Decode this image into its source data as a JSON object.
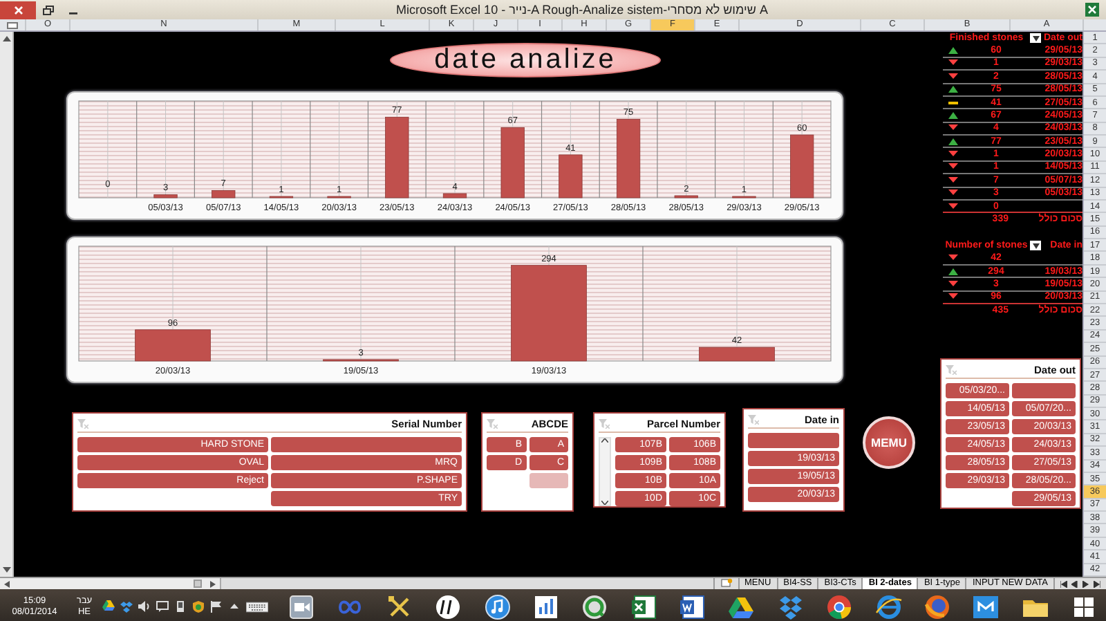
{
  "window": {
    "title": "Microsoft Excel 10 - נייר-A Rough-Analize sistem-שימוש לא מסחרי A"
  },
  "column_headers": [
    {
      "label": "O",
      "selected": false
    },
    {
      "label": "N",
      "selected": false
    },
    {
      "label": "M",
      "selected": false
    },
    {
      "label": "L",
      "selected": false
    },
    {
      "label": "K",
      "selected": false
    },
    {
      "label": "J",
      "selected": false
    },
    {
      "label": "I",
      "selected": false
    },
    {
      "label": "H",
      "selected": false
    },
    {
      "label": "G",
      "selected": false
    },
    {
      "label": "F",
      "selected": true
    },
    {
      "label": "E",
      "selected": false
    },
    {
      "label": "D",
      "selected": false
    },
    {
      "label": "C",
      "selected": false
    },
    {
      "label": "B",
      "selected": false
    },
    {
      "label": "A",
      "selected": false
    }
  ],
  "row_headers": [
    {
      "label": "1",
      "selected": false
    },
    {
      "label": "2",
      "selected": false
    },
    {
      "label": "3",
      "selected": false
    },
    {
      "label": "4",
      "selected": false
    },
    {
      "label": "5",
      "selected": false
    },
    {
      "label": "6",
      "selected": false
    },
    {
      "label": "7",
      "selected": false
    },
    {
      "label": "8",
      "selected": false
    },
    {
      "label": "9",
      "selected": false
    },
    {
      "label": "10",
      "selected": false
    },
    {
      "label": "11",
      "selected": false
    },
    {
      "label": "12",
      "selected": false
    },
    {
      "label": "13",
      "selected": false
    },
    {
      "label": "14",
      "selected": false
    },
    {
      "label": "15",
      "selected": false
    },
    {
      "label": "16",
      "selected": false
    },
    {
      "label": "17",
      "selected": false
    },
    {
      "label": "18",
      "selected": false
    },
    {
      "label": "19",
      "selected": false
    },
    {
      "label": "20",
      "selected": false
    },
    {
      "label": "21",
      "selected": false
    },
    {
      "label": "22",
      "selected": false
    },
    {
      "label": "23",
      "selected": false
    },
    {
      "label": "24",
      "selected": false
    },
    {
      "label": "25",
      "selected": false
    },
    {
      "label": "26",
      "selected": false
    },
    {
      "label": "27",
      "selected": false
    },
    {
      "label": "28",
      "selected": false
    },
    {
      "label": "29",
      "selected": false
    },
    {
      "label": "30",
      "selected": false
    },
    {
      "label": "31",
      "selected": false
    },
    {
      "label": "32",
      "selected": false
    },
    {
      "label": "33",
      "selected": false
    },
    {
      "label": "34",
      "selected": false
    },
    {
      "label": "35",
      "selected": false
    },
    {
      "label": "36",
      "selected": true
    },
    {
      "label": "37",
      "selected": false
    },
    {
      "label": "38",
      "selected": false
    },
    {
      "label": "39",
      "selected": false
    },
    {
      "label": "40",
      "selected": false
    },
    {
      "label": "41",
      "selected": false
    },
    {
      "label": "42",
      "selected": false
    }
  ],
  "banner": "date analize",
  "charts": [
    {
      "chart_data": {
        "type": "bar",
        "grid": true,
        "categories": [
          null,
          "05/03/13",
          "05/07/13",
          "14/05/13",
          "20/03/13",
          "23/05/13",
          "24/03/13",
          "24/05/13",
          "27/05/13",
          "28/05/13",
          "28/05/13",
          "29/03/13",
          "29/05/13"
        ],
        "values": [
          0,
          3,
          7,
          1,
          1,
          77,
          4,
          67,
          41,
          75,
          2,
          1,
          60
        ],
        "data_labels": true
      }
    },
    {
      "chart_data": {
        "type": "bar",
        "grid": true,
        "categories": [
          "20/03/13",
          "19/05/13",
          "19/03/13",
          null
        ],
        "values": [
          96,
          3,
          294,
          42
        ],
        "data_labels": true
      }
    }
  ],
  "finished_table": {
    "columns": [
      "Finished stones",
      "Date out"
    ],
    "rows": [
      {
        "kind": "up",
        "value": "60",
        "date": "29/05/13"
      },
      {
        "kind": "down",
        "value": "1",
        "date": "29/03/13"
      },
      {
        "kind": "down",
        "value": "2",
        "date": "28/05/13"
      },
      {
        "kind": "up",
        "value": "75",
        "date": "28/05/13"
      },
      {
        "kind": "flat",
        "value": "41",
        "date": "27/05/13"
      },
      {
        "kind": "up",
        "value": "67",
        "date": "24/05/13"
      },
      {
        "kind": "down",
        "value": "4",
        "date": "24/03/13"
      },
      {
        "kind": "up",
        "value": "77",
        "date": "23/05/13"
      },
      {
        "kind": "down",
        "value": "1",
        "date": "20/03/13"
      },
      {
        "kind": "down",
        "value": "1",
        "date": "14/05/13"
      },
      {
        "kind": "down",
        "value": "7",
        "date": "05/07/13"
      },
      {
        "kind": "down",
        "value": "3",
        "date": "05/03/13"
      },
      {
        "kind": "down",
        "value": "0"
      }
    ],
    "total": {
      "value": "339",
      "label": "סכום כולל"
    }
  },
  "number_table": {
    "columns": [
      "Number of stones",
      "Date in"
    ],
    "rows": [
      {
        "kind": "down",
        "value": "42"
      },
      {
        "kind": "up",
        "value": "294",
        "date": "19/03/13"
      },
      {
        "kind": "down",
        "value": "3",
        "date": "19/05/13"
      },
      {
        "kind": "down",
        "value": "96",
        "date": "20/03/13"
      }
    ],
    "total": {
      "value": "435",
      "label": "סכום כולל"
    }
  },
  "slicers": [
    {
      "title": "Serial Number",
      "items": [
        {
          "kind": "value",
          "label": "HARD STONE",
          "disabled": false
        },
        {
          "kind": "blank",
          "disabled": false
        },
        {
          "kind": "value",
          "label": "OVAL",
          "disabled": false
        },
        {
          "kind": "value",
          "label": "MRQ",
          "disabled": false
        },
        {
          "kind": "value",
          "label": "Reject",
          "disabled": false
        },
        {
          "kind": "value",
          "label": "P.SHAPE",
          "disabled": false
        },
        {
          "kind": "value",
          "label": "TRY",
          "disabled": false
        }
      ]
    },
    {
      "title": "ABCDE",
      "items": [
        {
          "kind": "value",
          "label": "B",
          "disabled": false
        },
        {
          "kind": "value",
          "label": "A",
          "disabled": false
        },
        {
          "kind": "value",
          "label": "D",
          "disabled": false
        },
        {
          "kind": "value",
          "label": "C",
          "disabled": false
        },
        {
          "kind": "blank",
          "disabled": true
        }
      ]
    },
    {
      "title": "Parcel Number",
      "items": [
        {
          "kind": "value",
          "label": "107B",
          "disabled": false
        },
        {
          "kind": "value",
          "label": "106B",
          "disabled": false
        },
        {
          "kind": "value",
          "label": "109B",
          "disabled": false
        },
        {
          "kind": "value",
          "label": "108B",
          "disabled": false
        },
        {
          "kind": "value",
          "label": "10B",
          "disabled": false
        },
        {
          "kind": "value",
          "label": "10A",
          "disabled": false
        },
        {
          "kind": "value",
          "label": "10D",
          "disabled": false
        },
        {
          "kind": "value",
          "label": "10C",
          "disabled": false
        }
      ]
    },
    {
      "title": "Date in",
      "items": [
        {
          "kind": "blank",
          "disabled": false
        },
        {
          "kind": "value",
          "label": "19/03/13",
          "disabled": false
        },
        {
          "kind": "value",
          "label": "19/05/13",
          "disabled": false
        },
        {
          "kind": "value",
          "label": "20/03/13",
          "disabled": false
        }
      ]
    },
    {
      "title": "Date out",
      "items": [
        {
          "kind": "value",
          "label": "05/03/20...",
          "disabled": false
        },
        {
          "kind": "blank",
          "disabled": false
        },
        {
          "kind": "value",
          "label": "14/05/13",
          "disabled": false
        },
        {
          "kind": "value",
          "label": "05/07/20...",
          "disabled": false
        },
        {
          "kind": "value",
          "label": "23/05/13",
          "disabled": false
        },
        {
          "kind": "value",
          "label": "20/03/13",
          "disabled": false
        },
        {
          "kind": "value",
          "label": "24/05/13",
          "disabled": false
        },
        {
          "kind": "value",
          "label": "24/03/13",
          "disabled": false
        },
        {
          "kind": "value",
          "label": "28/05/13",
          "disabled": false
        },
        {
          "kind": "value",
          "label": "27/05/13",
          "disabled": false
        },
        {
          "kind": "value",
          "label": "29/03/13",
          "disabled": false
        },
        {
          "kind": "value",
          "label": "28/05/20...",
          "disabled": false
        },
        {
          "kind": "value",
          "label": "29/05/13",
          "disabled": false
        }
      ]
    }
  ],
  "menu_button": "MEMU",
  "sheet_tabs": [
    {
      "label": "MENU",
      "selected": false
    },
    {
      "label": "BI4-SS",
      "selected": false
    },
    {
      "label": "BI3-CTs",
      "selected": false
    },
    {
      "label": "BI 2-dates",
      "selected": true
    },
    {
      "label": "BI 1-type",
      "selected": false
    },
    {
      "label": "INPUT NEW DATA",
      "selected": false
    }
  ],
  "taskbar": {
    "time": "15:09",
    "date": "08/01/2014",
    "language": "עבר",
    "language_code": "HE"
  }
}
